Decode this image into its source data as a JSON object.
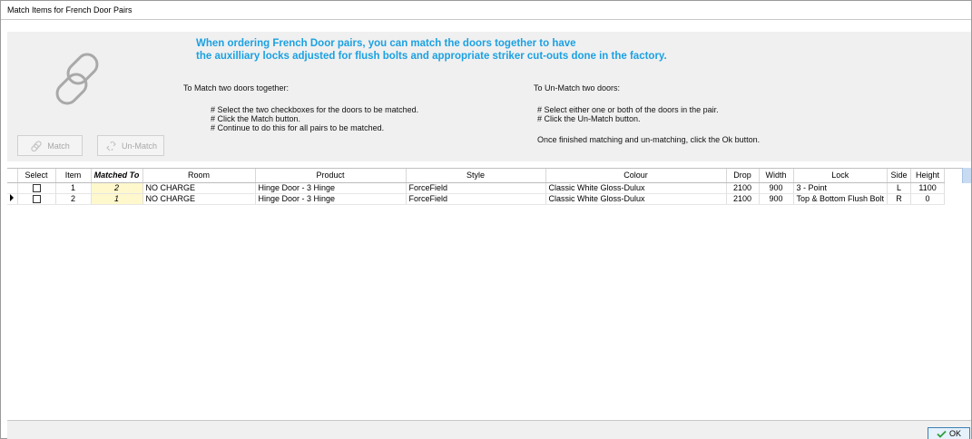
{
  "window": {
    "title": "Match Items for French Door Pairs"
  },
  "header": {
    "headline_line1": "When ordering French Door pairs, you can match the doors together to have",
    "headline_line2": "the auxilliary locks adjusted for flush bolts and appropriate striker cut-outs done in the factory."
  },
  "match_instructions": {
    "title": "To Match two doors together:",
    "steps": [
      "# Select the two checkboxes for the doors to be matched.",
      "# Click the Match button.",
      "# Continue to do this for all pairs to be matched."
    ]
  },
  "unmatch_instructions": {
    "title": "To Un-Match two doors:",
    "steps": [
      "# Select either one or both of the doors in the pair.",
      "# Click the Un-Match button."
    ],
    "footer": "Once finished matching and un-matching, click the Ok button."
  },
  "buttons": {
    "match_label": "Match",
    "unmatch_label": "Un-Match",
    "ok_label": "OK"
  },
  "grid": {
    "columns": [
      "Select",
      "Item",
      "Matched To",
      "Room",
      "Product",
      "Style",
      "Colour",
      "Drop",
      "Width",
      "Lock",
      "Side",
      "Height"
    ],
    "rows": [
      {
        "selected": false,
        "item": "1",
        "matched_to": "2",
        "room": "NO CHARGE",
        "product": "Hinge Door - 3 Hinge",
        "style": "ForceField",
        "colour": "Classic White Gloss-Dulux",
        "drop": "2100",
        "width": "900",
        "lock": "3 - Point",
        "side": "L",
        "height": "1100"
      },
      {
        "selected": false,
        "item": "2",
        "matched_to": "1",
        "room": "NO CHARGE",
        "product": "Hinge Door - 3 Hinge",
        "style": "ForceField",
        "colour": "Classic White Gloss-Dulux",
        "drop": "2100",
        "width": "900",
        "lock": "Top & Bottom Flush Bolt",
        "side": "R",
        "height": "0"
      }
    ]
  },
  "colors": {
    "headline": "#1ba1e2",
    "matched_cell": "#fff8cc",
    "ok_check": "#2e9e3a"
  }
}
